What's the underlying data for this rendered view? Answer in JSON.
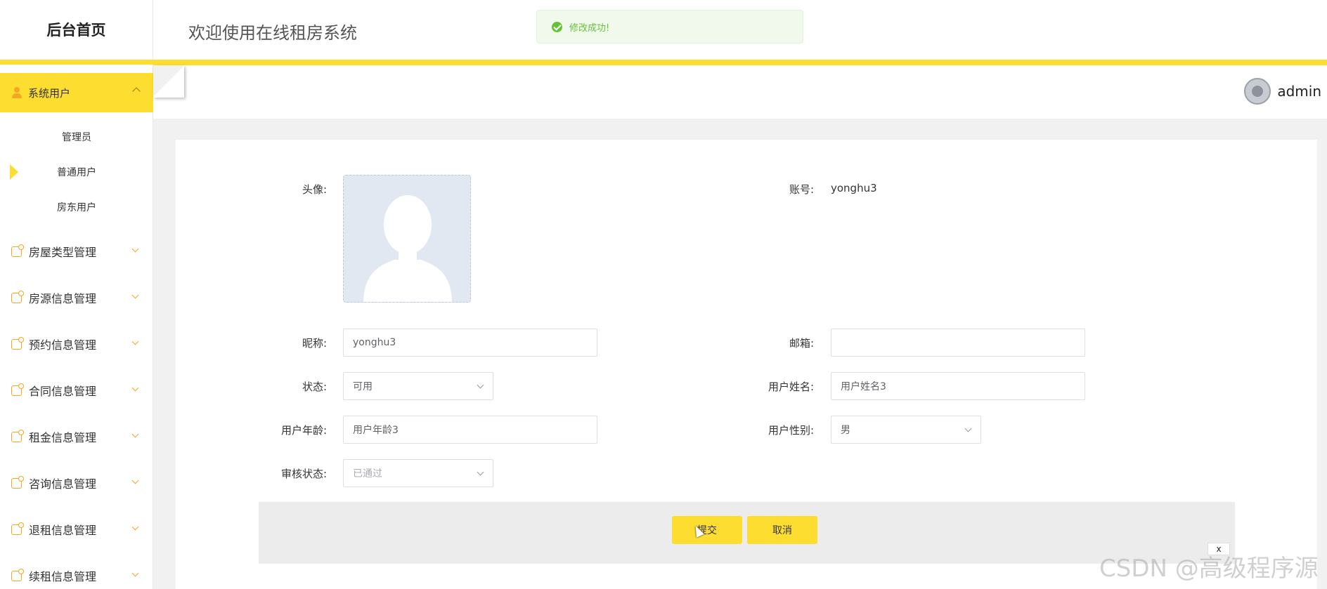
{
  "sidebar": {
    "logo": "后台首页",
    "active_group": "系统用户",
    "submenu": [
      "管理员",
      "普通用户",
      "房东用户"
    ],
    "items": [
      "房屋类型管理",
      "房源信息管理",
      "预约信息管理",
      "合同信息管理",
      "租金信息管理",
      "咨询信息管理",
      "退租信息管理",
      "续租信息管理"
    ]
  },
  "header": {
    "welcome": "欢迎使用在线租房系统",
    "username": "admin"
  },
  "toast": {
    "message": "修改成功!",
    "type": "success"
  },
  "form": {
    "avatar_label": "头像:",
    "account_label": "账号:",
    "account_value": "yonghu3",
    "nickname_label": "昵称:",
    "nickname_value": "yonghu3",
    "email_label": "邮箱:",
    "email_value": "",
    "status_label": "状态:",
    "status_value": "可用",
    "realname_label": "用户姓名:",
    "realname_value": "用户姓名3",
    "age_label": "用户年龄:",
    "age_value": "用户年龄3",
    "gender_label": "用户性别:",
    "gender_value": "男",
    "review_label": "审核状态:",
    "review_value": "已通过"
  },
  "buttons": {
    "submit": "提交",
    "cancel": "取消"
  },
  "close_label": "x",
  "watermark": "CSDN @高级程序源",
  "colors": {
    "accent": "#fddd2f",
    "success": "#67c23a",
    "icon": "#f5a623"
  }
}
